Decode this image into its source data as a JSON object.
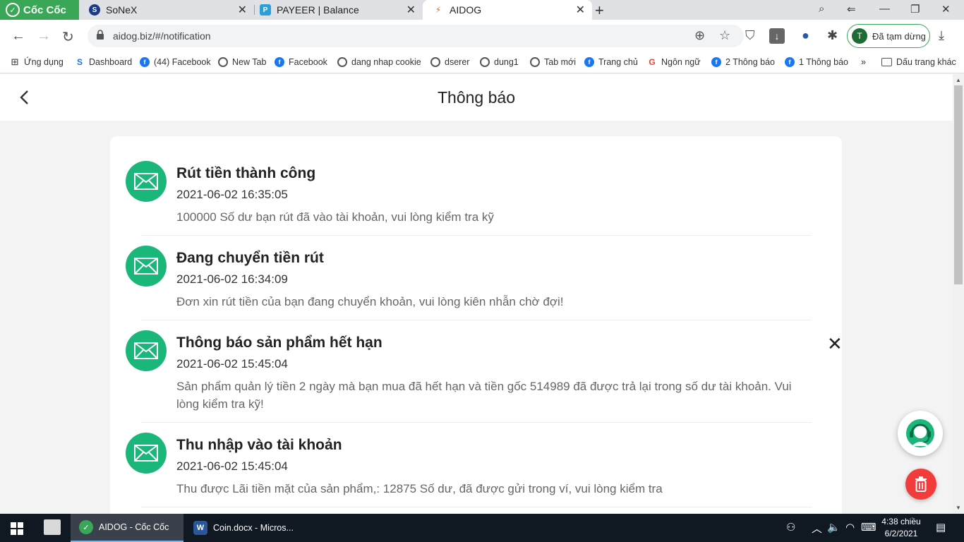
{
  "browser": {
    "brand": "Cốc Cốc",
    "tabs": [
      {
        "title": "SoNeX"
      },
      {
        "title": "PAYEER | Balance"
      },
      {
        "title": "AIDOG"
      }
    ],
    "url": "aidog.biz/#/notification",
    "profile_initial": "T",
    "profile_status": "Đã tạm dừng"
  },
  "bookmarks": [
    {
      "label": "Ứng dụng",
      "icon": "apps-grid-icon"
    },
    {
      "label": "Dashboard",
      "icon": "s-icon"
    },
    {
      "label": "(44) Facebook",
      "icon": "facebook-icon"
    },
    {
      "label": "New Tab",
      "icon": "globe-icon"
    },
    {
      "label": "Facebook",
      "icon": "facebook-icon"
    },
    {
      "label": "dang nhap cookie",
      "icon": "globe-icon"
    },
    {
      "label": "dserer",
      "icon": "globe-icon"
    },
    {
      "label": "dung1",
      "icon": "globe-icon"
    },
    {
      "label": "Tab mới",
      "icon": "globe-icon"
    },
    {
      "label": "Trang chủ",
      "icon": "facebook-icon"
    },
    {
      "label": "Ngôn ngữ",
      "icon": "google-icon"
    },
    {
      "label": "2 Thông báo",
      "icon": "facebook-icon"
    },
    {
      "label": "1 Thông báo",
      "icon": "facebook-icon"
    },
    {
      "label": "»",
      "icon": ""
    },
    {
      "label": "Dấu trang khác",
      "icon": "folder-icon"
    }
  ],
  "page": {
    "title": "Thông báo"
  },
  "notifications": [
    {
      "title": "Rút tiền thành công",
      "time": "2021-06-02 16:35:05",
      "message": "100000 Số dư bạn rút đã vào tài khoản, vui lòng kiểm tra kỹ"
    },
    {
      "title": "Đang chuyển tiền rút",
      "time": "2021-06-02 16:34:09",
      "message": "Đơn xin rút tiền của bạn đang chuyển khoản, vui lòng kiên nhẫn chờ đợi!"
    },
    {
      "title": "Thông báo sản phẩm hết hạn",
      "time": "2021-06-02 15:45:04",
      "message": "Sản phẩm quản lý tiền 2 ngày mà bạn mua đã hết hạn và tiền gốc 514989 đã được trả lại trong số dư tài khoản. Vui lòng kiểm tra kỹ!"
    },
    {
      "title": "Thu nhập vào tài khoản",
      "time": "2021-06-02 15:45:04",
      "message": "Thu được Lãi tiền mặt của sản phẩm,: 12875 Số dư, đã được gửi trong ví, vui lòng kiểm tra"
    }
  ],
  "taskbar": {
    "tasks": [
      {
        "label": "AIDOG - Cốc Cốc"
      },
      {
        "label": "Coin.docx - Micros..."
      }
    ],
    "time": "4:38 chiều",
    "date": "6/2/2021"
  },
  "colors": {
    "accent_green": "#1ab67a",
    "delete_red": "#f23b3b",
    "browser_green": "#3aa757"
  }
}
